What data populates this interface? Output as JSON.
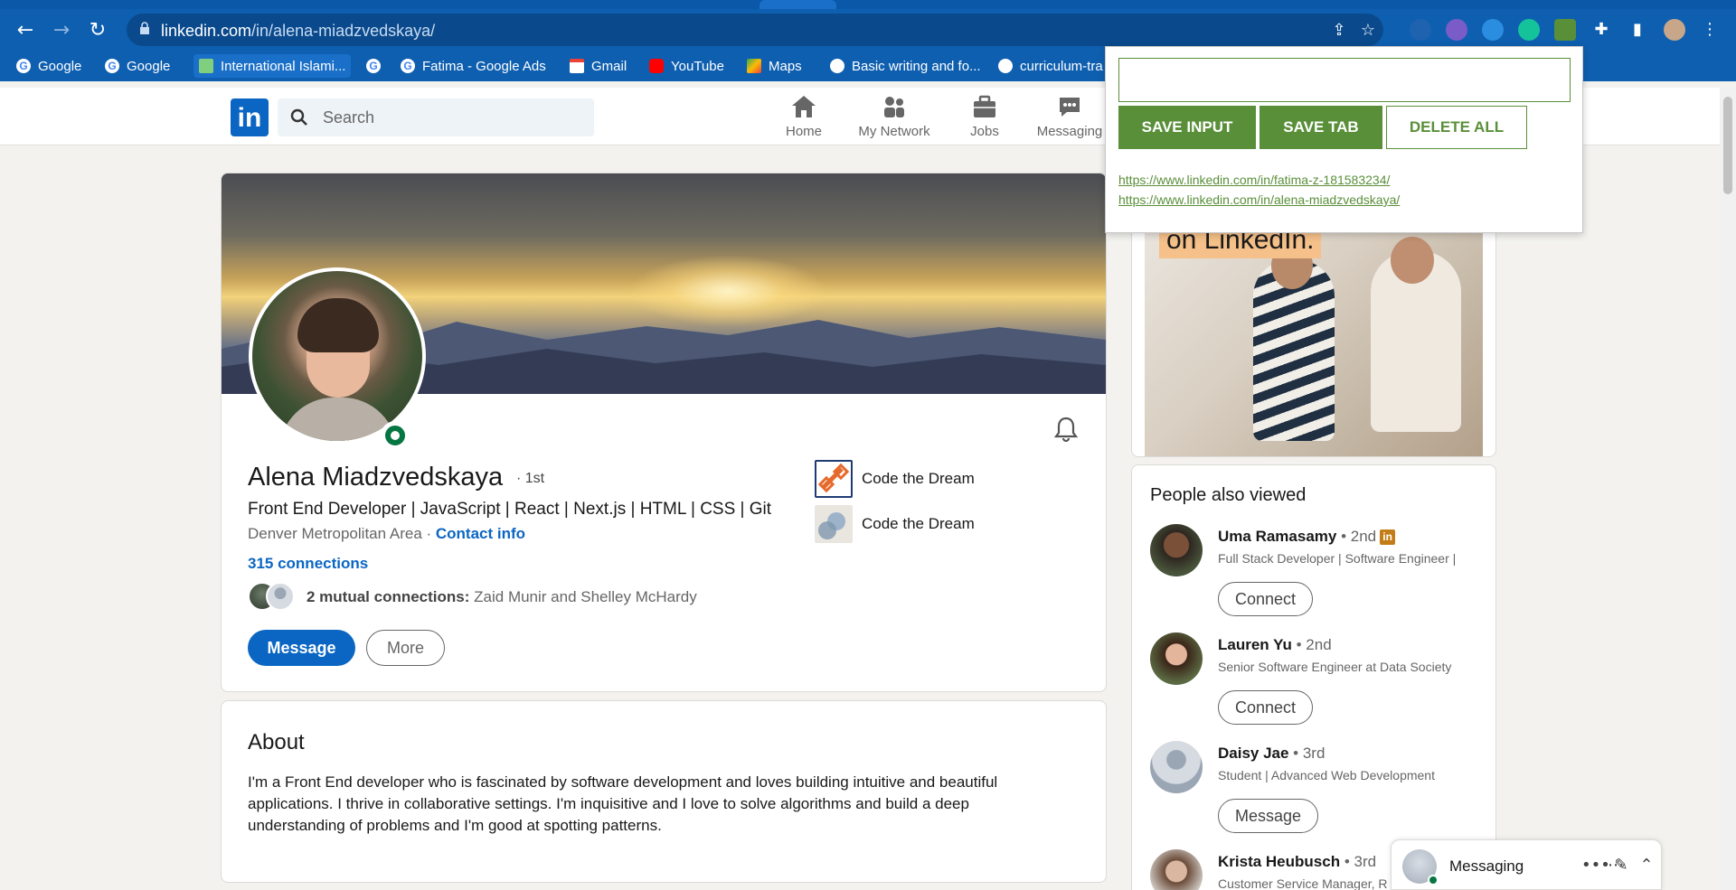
{
  "browser": {
    "url_host": "linkedin.com",
    "url_path": "/in/alena-miadzvedskaya/",
    "bookmarks": [
      {
        "label": "Google",
        "icon": "google-icon"
      },
      {
        "label": "Google",
        "icon": "google-icon"
      },
      {
        "label": "International Islami...",
        "icon": "site-icon"
      },
      {
        "label": "",
        "icon": "google-icon"
      },
      {
        "label": "Fatima - Google Ads",
        "icon": "google-icon"
      },
      {
        "label": "Gmail",
        "icon": "gmail-icon"
      },
      {
        "label": "YouTube",
        "icon": "youtube-icon"
      },
      {
        "label": "Maps",
        "icon": "maps-icon"
      },
      {
        "label": "Basic writing and fo...",
        "icon": "github-icon"
      },
      {
        "label": "curriculum-tra",
        "icon": "github-icon"
      }
    ]
  },
  "linkedin_nav": {
    "logo": "in",
    "search_placeholder": "Search",
    "items": [
      {
        "label": "Home",
        "icon": "home-icon"
      },
      {
        "label": "My Network",
        "icon": "network-icon"
      },
      {
        "label": "Jobs",
        "icon": "jobs-icon"
      },
      {
        "label": "Messaging",
        "icon": "messaging-icon"
      }
    ]
  },
  "profile": {
    "name": "Alena Miadzvedskaya",
    "degree": "· 1st",
    "headline": "Front End Developer | JavaScript | React | Next.js | HTML | CSS | Git",
    "location": "Denver Metropolitan Area · ",
    "contact_info": "Contact info",
    "connections": "315 connections",
    "mutual_bold": "2 mutual connections:",
    "mutual_names": " Zaid Munir and Shelley McHardy",
    "message_button": "Message",
    "more_button": "More",
    "experience": [
      {
        "name": "Code the Dream"
      },
      {
        "name": "Code the Dream"
      }
    ]
  },
  "about": {
    "title": "About",
    "text": "I'm a Front End developer who is fascinated by software development and loves building intuitive and beautiful applications. I thrive in collaborative settings. I'm inquisitive and I love to solve algorithms and build a deep understanding of problems and I'm good at spotting patterns."
  },
  "ad": {
    "tag": "on LinkedIn."
  },
  "people_also_viewed": {
    "title": "People also viewed",
    "people": [
      {
        "name": "Uma Ramasamy",
        "degree": " • 2nd",
        "subtitle": "Full Stack Developer | Software Engineer |",
        "button": "Connect",
        "badge": "in"
      },
      {
        "name": "Lauren Yu",
        "degree": " • 2nd",
        "subtitle": "Senior Software Engineer at Data Society",
        "button": "Connect",
        "badge": ""
      },
      {
        "name": "Daisy Jae",
        "degree": " • 3rd",
        "subtitle": "Student | Advanced Web Development",
        "button": "Message",
        "badge": ""
      },
      {
        "name": "Krista Heubusch",
        "degree": " • 3rd",
        "subtitle": "Customer Service Manager, R",
        "button": "",
        "badge": ""
      }
    ]
  },
  "messaging": {
    "label": "Messaging"
  },
  "popup": {
    "input_value": "",
    "save_input": "SAVE INPUT",
    "save_tab": "SAVE TAB",
    "delete_all": "DELETE ALL",
    "links": [
      "https://www.linkedin.com/in/fatima-z-181583234/",
      "https://www.linkedin.com/in/alena-miadzvedskaya/"
    ],
    "accent": "#5a8f3a"
  }
}
